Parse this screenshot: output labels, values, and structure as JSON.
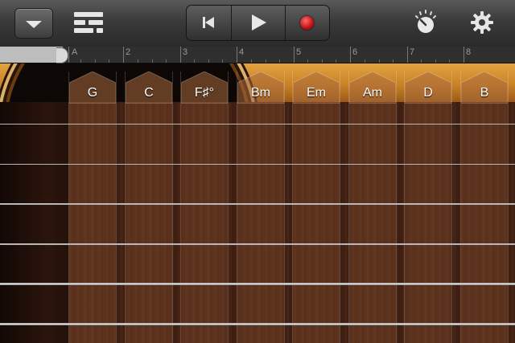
{
  "toolbar": {
    "menu_icon": "chevron-down-icon",
    "tracks_icon": "tracks-view-icon",
    "transport": [
      "skip-back-icon",
      "play-icon",
      "record-icon"
    ],
    "record_color": "#d01818",
    "right_icons": [
      "metronome-knob-icon",
      "gear-icon"
    ]
  },
  "ruler": {
    "section_marker": "A",
    "bars": [
      "2",
      "3",
      "4",
      "5",
      "6",
      "7",
      "8"
    ]
  },
  "chords": [
    "G",
    "C",
    "F♯°",
    "Bm",
    "Em",
    "Am",
    "D",
    "B"
  ],
  "strings_count": 6,
  "colors": {
    "wood": "#c98228",
    "fretboard": "#3b1d12"
  }
}
